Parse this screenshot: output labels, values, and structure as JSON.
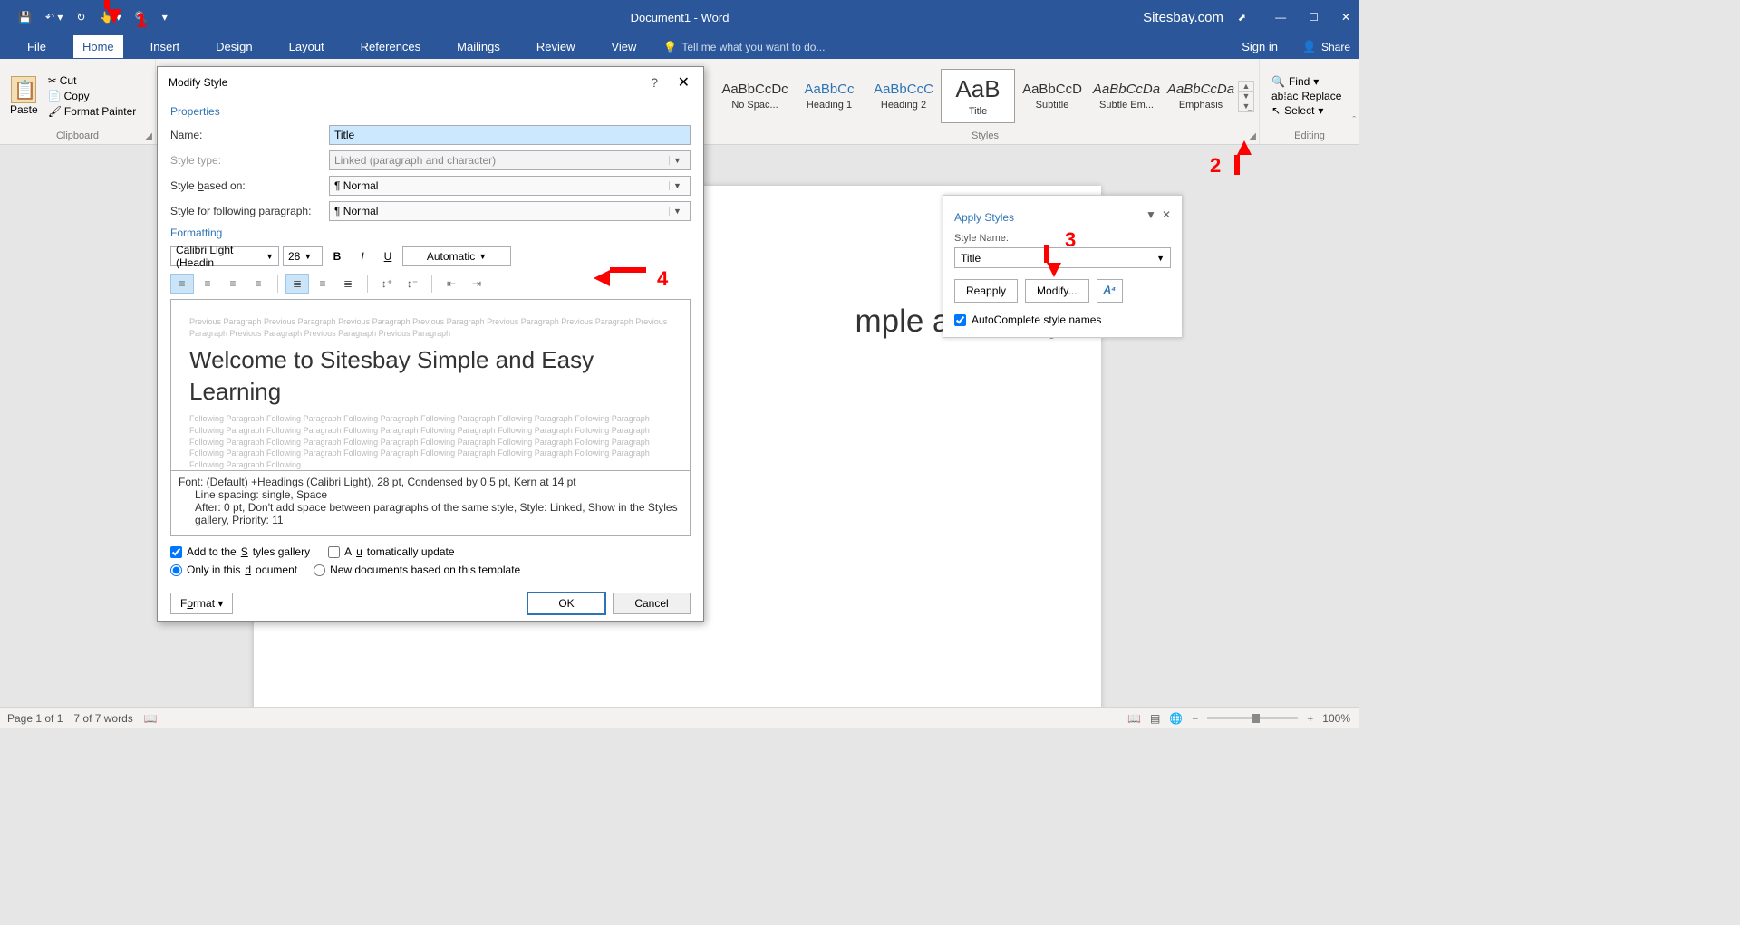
{
  "titlebar": {
    "title": "Document1 - Word",
    "site": "Sitesbay.com"
  },
  "tabs": {
    "file": "File",
    "home": "Home",
    "insert": "Insert",
    "design": "Design",
    "layout": "Layout",
    "references": "References",
    "mailings": "Mailings",
    "review": "Review",
    "view": "View",
    "tellme": "Tell me what you want to do...",
    "signin": "Sign in",
    "share": "Share"
  },
  "clipboard": {
    "paste": "Paste",
    "cut": "Cut",
    "copy": "Copy",
    "formatpainter": "Format Painter",
    "group": "Clipboard"
  },
  "styles": {
    "group": "Styles",
    "items": [
      {
        "preview": "AaBbCcDc",
        "name": "No Spac..."
      },
      {
        "preview": "AaBbCc",
        "name": "Heading 1",
        "blue": true
      },
      {
        "preview": "AaBbCcC",
        "name": "Heading 2",
        "blue": true
      },
      {
        "preview": "AaB",
        "name": "Title",
        "title": true,
        "selected": true
      },
      {
        "preview": "AaBbCcD",
        "name": "Subtitle"
      },
      {
        "preview": "AaBbCcDa",
        "name": "Subtle Em...",
        "italic": true
      },
      {
        "preview": "AaBbCcDa",
        "name": "Emphasis",
        "italic": true
      }
    ]
  },
  "editing": {
    "group": "Editing",
    "find": "Find",
    "replace": "Replace",
    "select": "Select"
  },
  "dialog": {
    "title": "Modify Style",
    "props_head": "Properties",
    "name_label": "Name:",
    "name_value": "Title",
    "type_label": "Style type:",
    "type_value": "Linked (paragraph and character)",
    "based_label": "Style based on:",
    "based_value": "¶ Normal",
    "follow_label": "Style for following paragraph:",
    "follow_value": "¶ Normal",
    "format_head": "Formatting",
    "font": "Calibri Light (Headin",
    "size": "28",
    "color": "Automatic",
    "preview_gray": "Previous Paragraph Previous Paragraph Previous Paragraph Previous Paragraph Previous Paragraph Previous Paragraph Previous Paragraph Previous Paragraph Previous Paragraph Previous Paragraph",
    "preview_title": "Welcome to Sitesbay Simple and Easy Learning",
    "preview_follow": "Following Paragraph Following Paragraph Following Paragraph Following Paragraph Following Paragraph Following Paragraph Following Paragraph Following Paragraph Following Paragraph Following Paragraph Following Paragraph Following Paragraph Following Paragraph Following Paragraph Following Paragraph Following Paragraph Following Paragraph Following Paragraph Following Paragraph Following Paragraph Following Paragraph Following Paragraph Following Paragraph Following Paragraph Following Paragraph Following",
    "desc1": "Font: (Default) +Headings (Calibri Light), 28 pt, Condensed by  0.5 pt, Kern at 14 pt",
    "desc2": "Line spacing:  single, Space",
    "desc3": "After:  0 pt, Don't add space between paragraphs of the same style, Style: Linked, Show in the Styles gallery, Priority: 11",
    "add_gallery": "Add to the Styles gallery",
    "auto_update": "Automatically update",
    "only_doc": "Only in this document",
    "new_docs": "New documents based on this template",
    "format_btn": "Format",
    "ok": "OK",
    "cancel": "Cancel"
  },
  "apply": {
    "title": "Apply Styles",
    "label": "Style Name:",
    "value": "Title",
    "reapply": "Reapply",
    "modify": "Modify...",
    "autocomplete": "AutoComplete style names"
  },
  "page": {
    "text": "mple and Easy"
  },
  "status": {
    "page": "Page 1 of 1",
    "words": "7 of 7 words",
    "zoom": "100%"
  },
  "annotations": {
    "1": "1",
    "2": "2",
    "3": "3",
    "4": "4"
  }
}
